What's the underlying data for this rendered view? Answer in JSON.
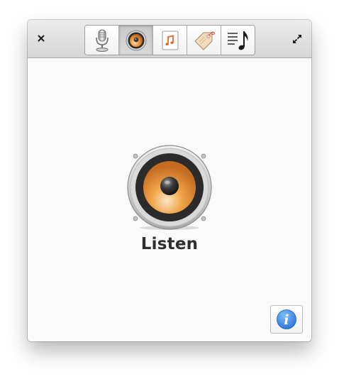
{
  "window": {
    "controls": {
      "close_icon": "close-icon",
      "fullscreen_icon": "fullscreen-icon"
    }
  },
  "toolbar": {
    "selected_index": 1,
    "tools": [
      {
        "id": "microphone",
        "icon": "microphone-icon"
      },
      {
        "id": "listen",
        "icon": "speaker-icon"
      },
      {
        "id": "music",
        "icon": "music-note-icon"
      },
      {
        "id": "tag",
        "icon": "tag-icon"
      },
      {
        "id": "lyrics",
        "icon": "lyrics-note-icon"
      }
    ]
  },
  "main": {
    "mode_label": "Listen",
    "mode_icon": "speaker-icon"
  },
  "info_button": {
    "glyph": "i",
    "icon": "info-icon",
    "color": "#2f7fe0"
  },
  "colors": {
    "speaker_cone": "#e7922e",
    "speaker_ring": "#2a2a2a",
    "titlebar": "#dcdcdc"
  }
}
